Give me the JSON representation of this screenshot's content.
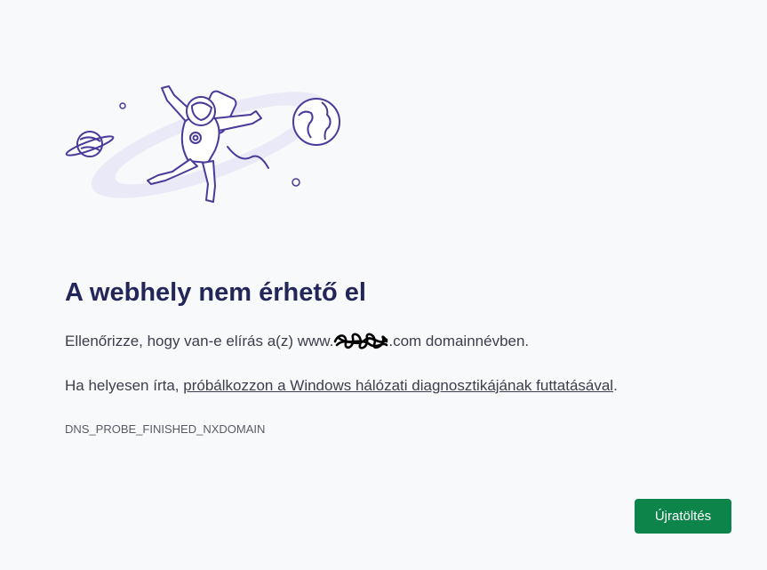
{
  "error": {
    "title": "A webhely nem érhető el",
    "check_prefix": "Ellenőrizze, hogy van-e elírás a(z) www.",
    "check_suffix": ".com domainnévben.",
    "hint_prefix": "Ha helyesen írta, ",
    "hint_link": "próbálkozzon a Windows hálózati diagnosztikájának futtatásával",
    "hint_suffix": ".",
    "code": "DNS_PROBE_FINISHED_NXDOMAIN"
  },
  "actions": {
    "reload_label": "Újratöltés"
  },
  "colors": {
    "title": "#232659",
    "accent": "#0c844a",
    "illustration_stroke": "#4a3a9a",
    "illustration_fill": "#e6e3f6"
  },
  "icons": {
    "illustration": "astronaut-floating-in-space-illustration",
    "redaction": "redaction-scribble"
  }
}
